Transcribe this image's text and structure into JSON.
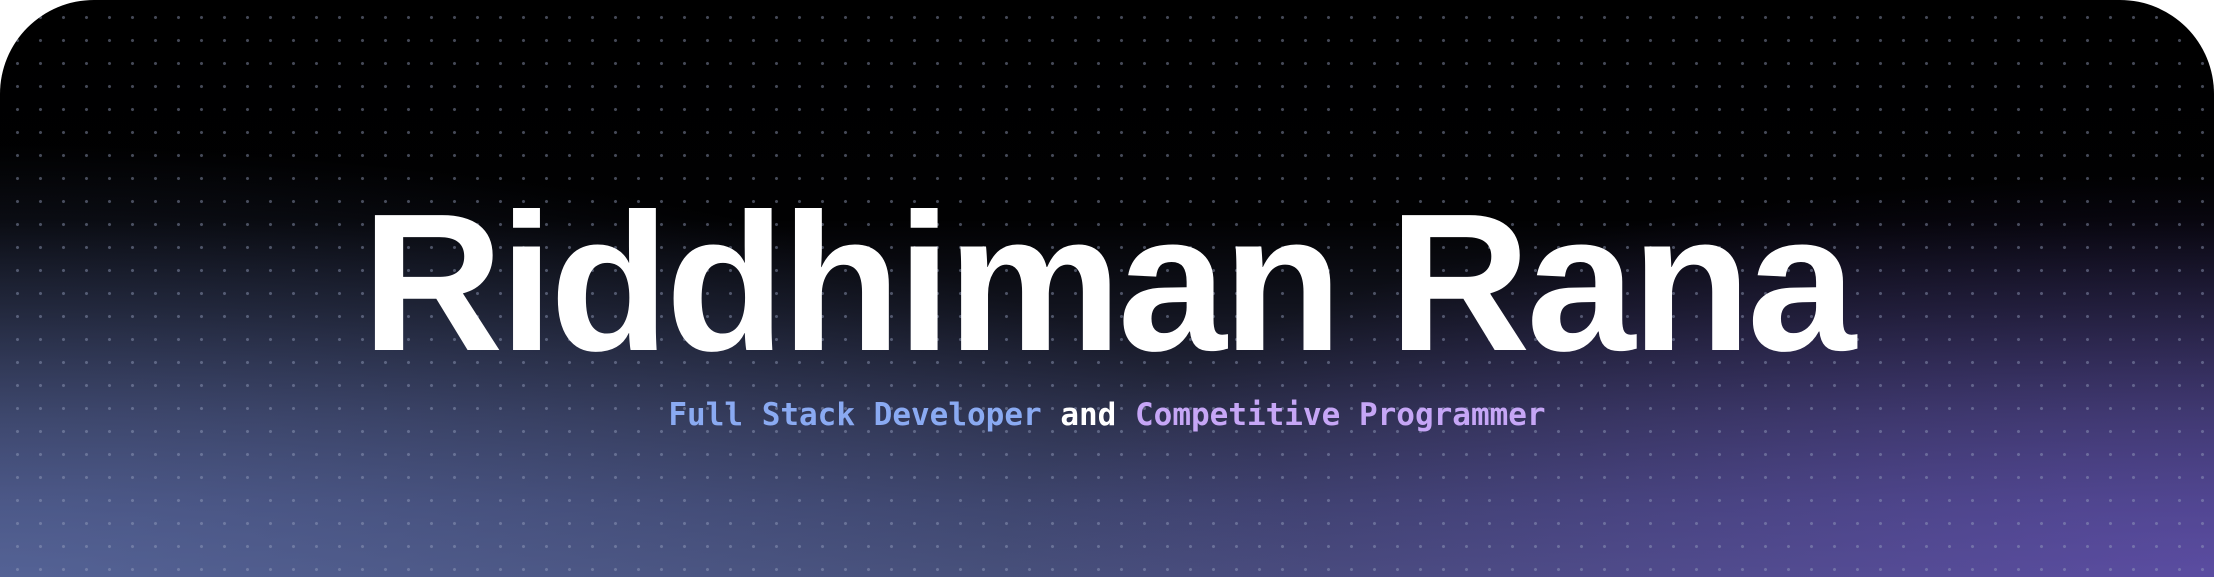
{
  "hero": {
    "name": "Riddhiman Rana",
    "tagline": {
      "role_one": "Full Stack Developer",
      "connector": "and",
      "role_two": "Competitive Programmer"
    }
  },
  "colors": {
    "background_top": "#000000",
    "background_bottom_left": "#4a5478",
    "background_bottom_right": "#4a3a80",
    "name_text": "#ffffff",
    "role_one_text": "#8aaaf2",
    "role_two_text": "#c6a6f6",
    "connector_text": "#ffffff"
  }
}
